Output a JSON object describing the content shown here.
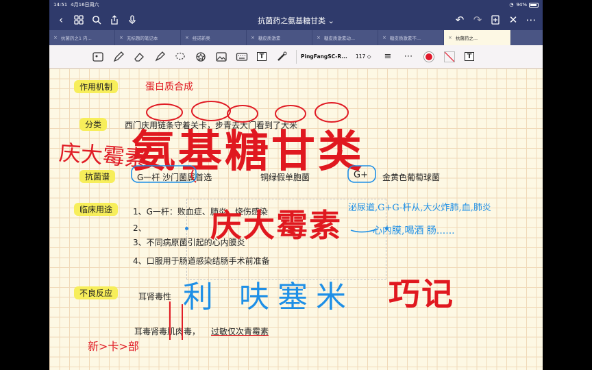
{
  "status_bar": {
    "time": "14:51",
    "date": "4月16日周六",
    "battery": "94%"
  },
  "nav": {
    "doc_title": "抗菌药之氨基糖甘类 ⌄"
  },
  "tabs": [
    {
      "label": "抗菌药之1 内..."
    },
    {
      "label": "无标题的笔记本"
    },
    {
      "label": "经诺新奥"
    },
    {
      "label": "糖皮质激素"
    },
    {
      "label": "糖皮质激素动..."
    },
    {
      "label": "糖皮质激素不..."
    },
    {
      "label": "抗菌药之..."
    }
  ],
  "toolbar": {
    "font_name": "PingFangSC-R...",
    "font_size": "117 ◇",
    "pen_color": "#e0192c"
  },
  "note": {
    "sec1_label": "作用机制",
    "sec1_hand": "蛋白质合成",
    "sec2_label": "分类",
    "sec2_text": "西门庆用链条守着关卡，步青去大门看到了大米",
    "sec3_label": "抗菌谱",
    "sec3_g_minus": "G一杆 沙门菌属首选",
    "sec3_pseudo": "铜绿假单胞菌",
    "sec3_g_plus": "G+",
    "sec3_staph": "金黄色葡萄球菌",
    "sec4_label": "临床用途",
    "sec4_item1": "1、G一杆：败血症、肺炎，烧伤感染",
    "sec4_item2": "2、",
    "sec4_item3": "3、不同病原菌引起的心内膜炎",
    "sec4_item4": "4、口服用于肠道感染结肠手术前准备",
    "sec5_label": "不良反应",
    "sec5_text": "耳肾毒性",
    "summary_text_a": "耳毒肾毒肌肉毒，",
    "summary_text_b": "过敏仅次青霉素",
    "big_title": "氨基糖甘类",
    "sub_title": "庆大霉素",
    "qiaoji": "巧记",
    "hand_qingda": "庆大霉素",
    "hand_blue_top": "泌尿道,G+G-杆从,大火炸肺,血,肺炎",
    "hand_blue_mid": "心内膜,喝酒 肠......",
    "hand_blue_big": "利 呋塞米",
    "hand_new": "新>卡>部"
  },
  "colors": {
    "nav_bg": "#2f3a6b",
    "paper": "#fdf8e4",
    "grid": "#f0d9b8",
    "highlight": "#f7ee5a",
    "ink_red": "#e0181f",
    "ink_blue": "#1e8fe6"
  }
}
